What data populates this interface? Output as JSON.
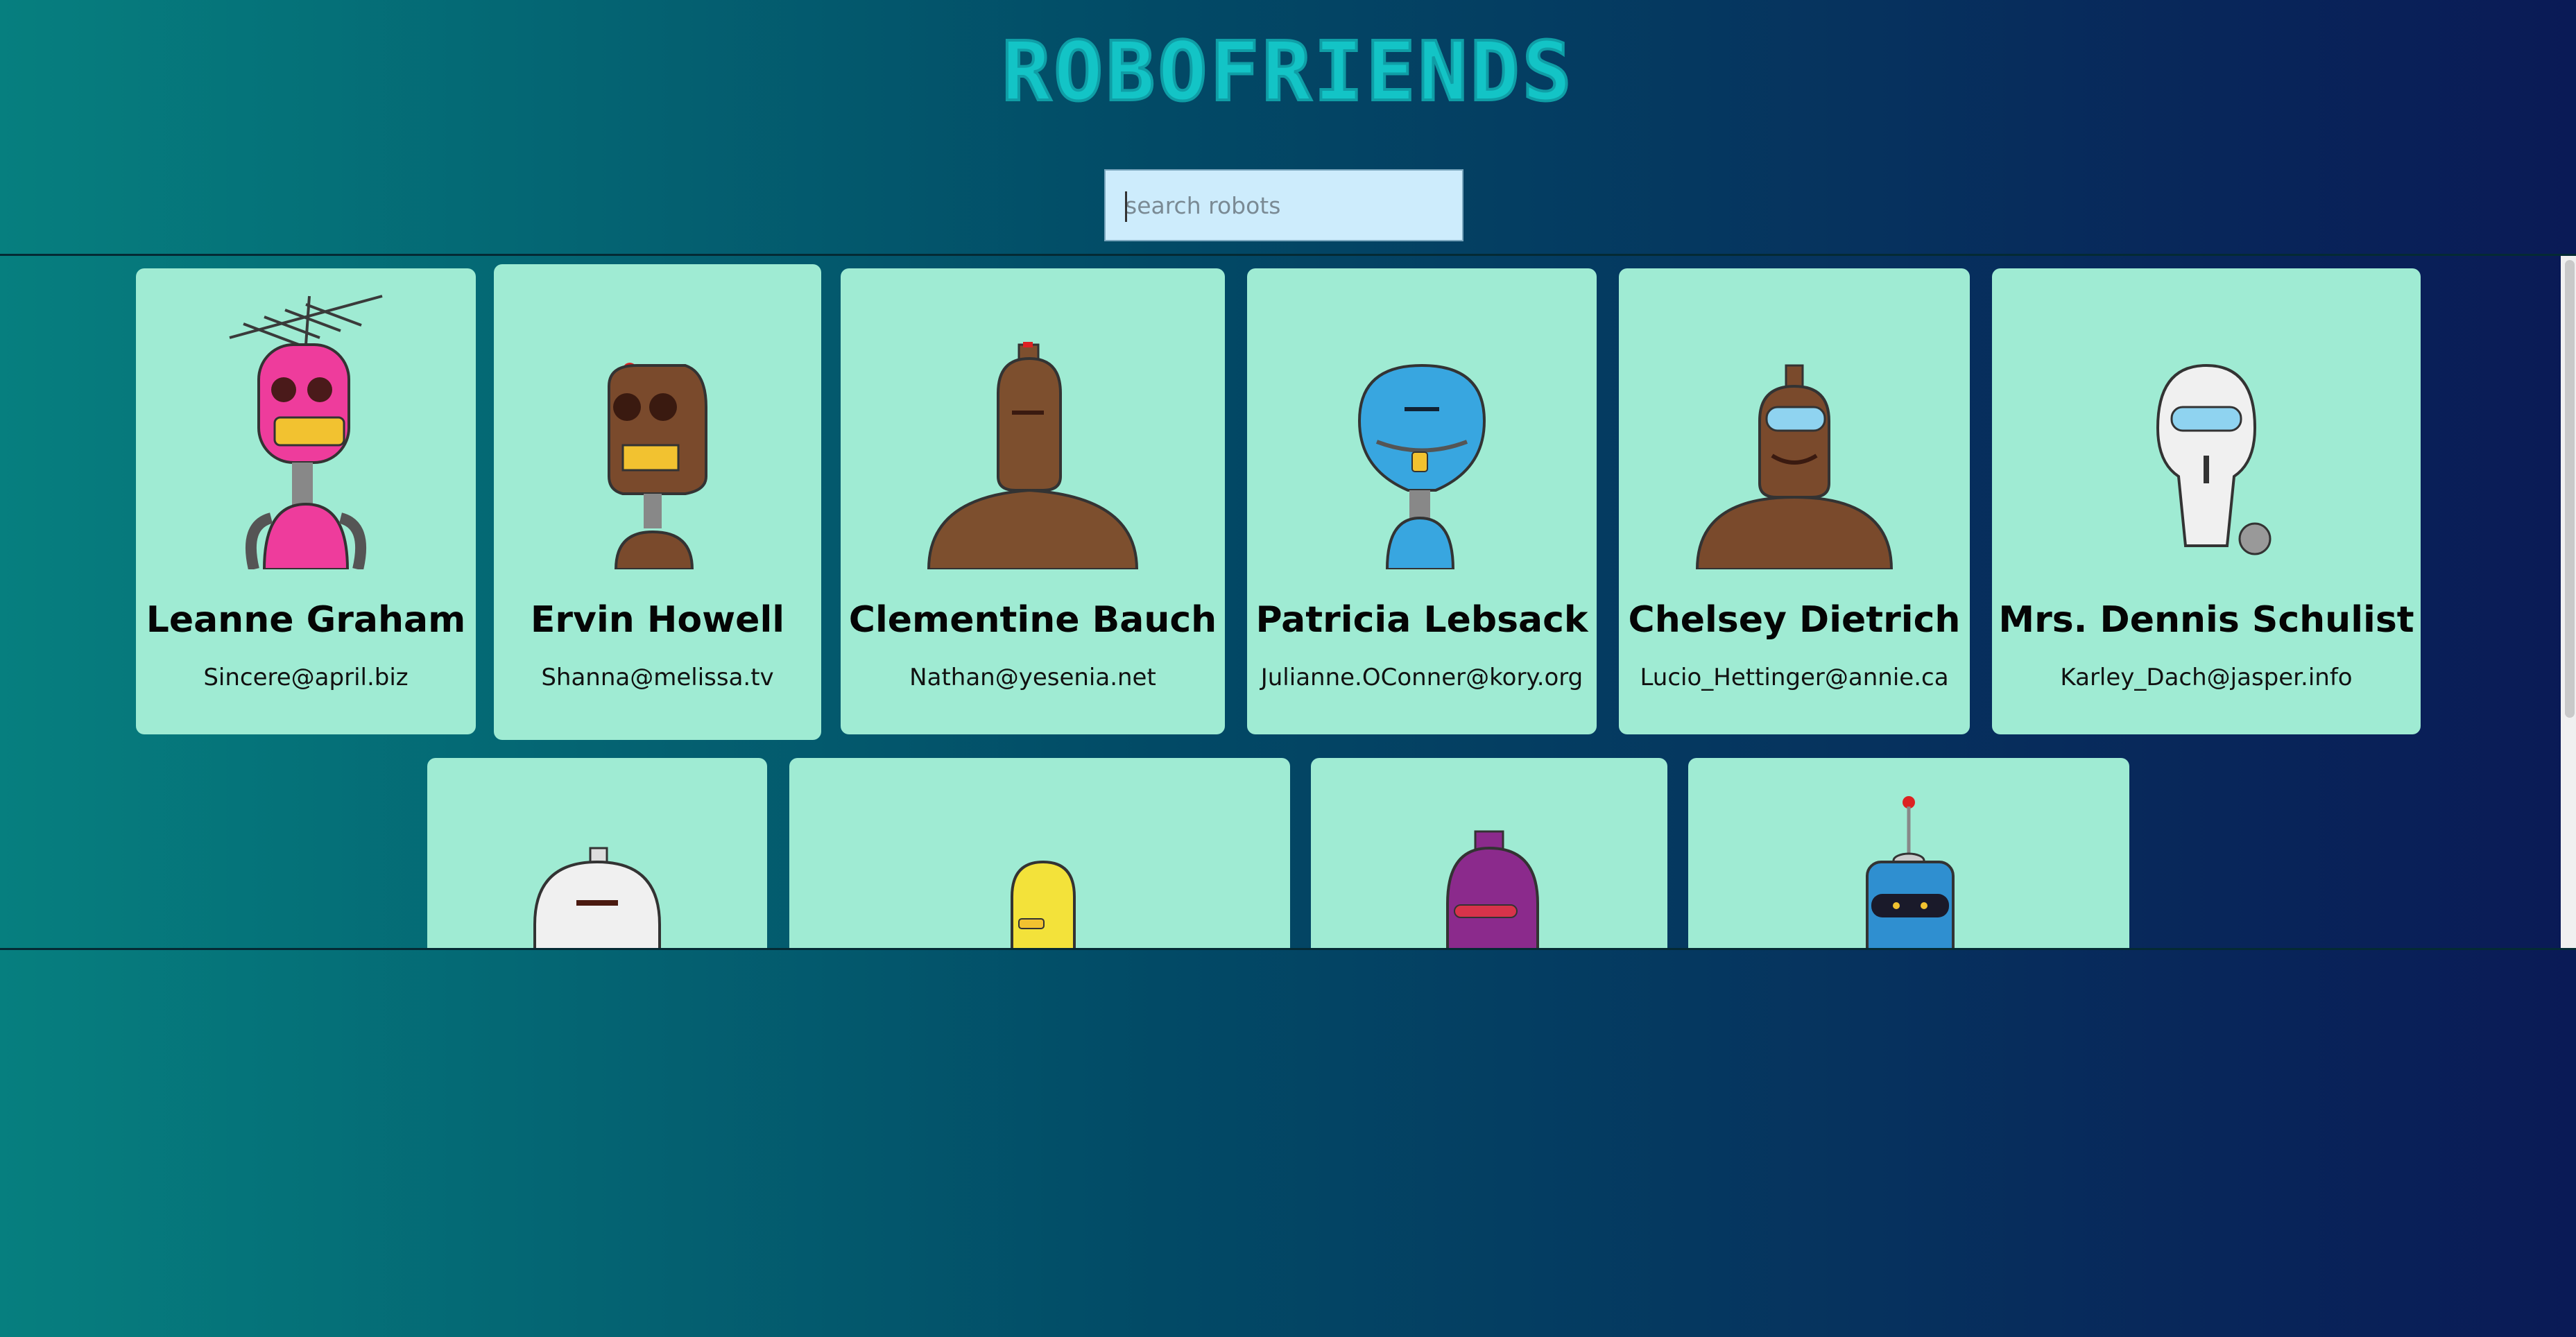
{
  "header": {
    "title": "ROBOFRIENDS"
  },
  "search": {
    "placeholder": "search robots",
    "value": ""
  },
  "robots": [
    {
      "name": "Leanne Graham",
      "email": "Sincere@april.biz",
      "color": "#ee3c9c"
    },
    {
      "name": "Ervin Howell",
      "email": "Shanna@melissa.tv",
      "color": "#7a4a2c"
    },
    {
      "name": "Clementine Bauch",
      "email": "Nathan@yesenia.net",
      "color": "#7d4f2e"
    },
    {
      "name": "Patricia Lebsack",
      "email": "Julianne.OConner@kory.org",
      "color": "#38a6e0"
    },
    {
      "name": "Chelsey Dietrich",
      "email": "Lucio_Hettinger@annie.ca",
      "color": "#7a4a2c"
    },
    {
      "name": "Mrs. Dennis Schulist",
      "email": "Karley_Dach@jasper.info",
      "color": "#f0f0f0"
    },
    {
      "name": "",
      "email": "",
      "color": "#f0f0f0"
    },
    {
      "name": "",
      "email": "",
      "color": "#f3e23a"
    },
    {
      "name": "",
      "email": "",
      "color": "#8b2a8c"
    },
    {
      "name": "",
      "email": "",
      "color": "#2f8fd0"
    }
  ],
  "colors": {
    "card": "#9febd3",
    "title": "#13c4c6",
    "search_bg": "#cdecfc"
  }
}
